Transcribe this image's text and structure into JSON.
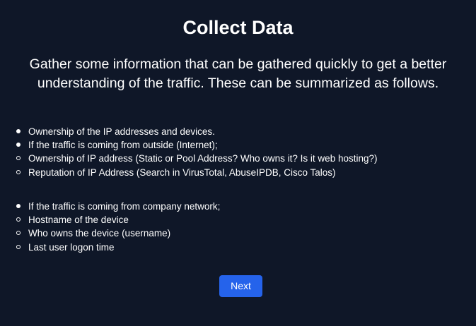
{
  "page": {
    "title": "Collect Data",
    "intro": "Gather some information that can be gathered quickly to get a better understanding of the traffic. These can be summarized as follows."
  },
  "list_one": {
    "items": [
      {
        "text": "Ownership of the IP addresses and devices.",
        "marker": "disc"
      },
      {
        "text": "If the traffic is coming from outside (Internet);",
        "marker": "disc"
      },
      {
        "text": "Ownership of IP address (Static or Pool Address? Who owns it? Is it web hosting?)",
        "marker": "circle"
      },
      {
        "text": "Reputation of IP Address (Search in VirusTotal, AbuseIPDB, Cisco Talos)",
        "marker": "circle"
      }
    ]
  },
  "list_two": {
    "items": [
      {
        "text": "If the traffic is coming from company network;",
        "marker": "disc"
      },
      {
        "text": "Hostname of the device",
        "marker": "circle"
      },
      {
        "text": "Who owns the device (username)",
        "marker": "circle"
      },
      {
        "text": "Last user logon time",
        "marker": "circle"
      }
    ]
  },
  "actions": {
    "next_label": "Next"
  },
  "colors": {
    "background": "#0f1728",
    "text": "#ffffff",
    "button": "#2563eb"
  }
}
